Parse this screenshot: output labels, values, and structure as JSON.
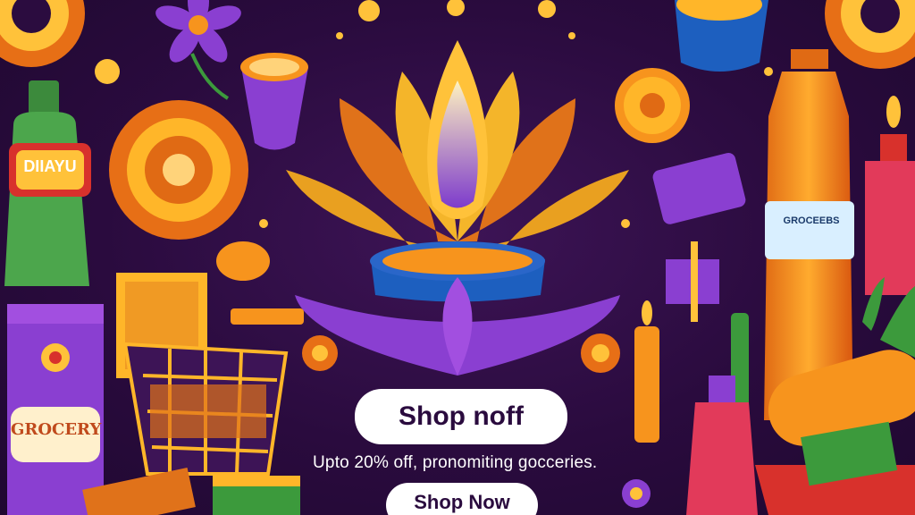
{
  "banner": {
    "primary_cta": "Shop noff",
    "promo_text": "Upto 20% off, pronomiting gocceries.",
    "secondary_cta": "Shop Now"
  },
  "product_labels": {
    "grocery_box": "GROCERY",
    "green_bottle": "DIIAYU",
    "orange_bottle": "GROCEEBS"
  },
  "colors": {
    "background": "#2b0c3f",
    "accent_orange": "#f7941d",
    "accent_purple": "#8a3fd1",
    "accent_red": "#d8312c"
  }
}
